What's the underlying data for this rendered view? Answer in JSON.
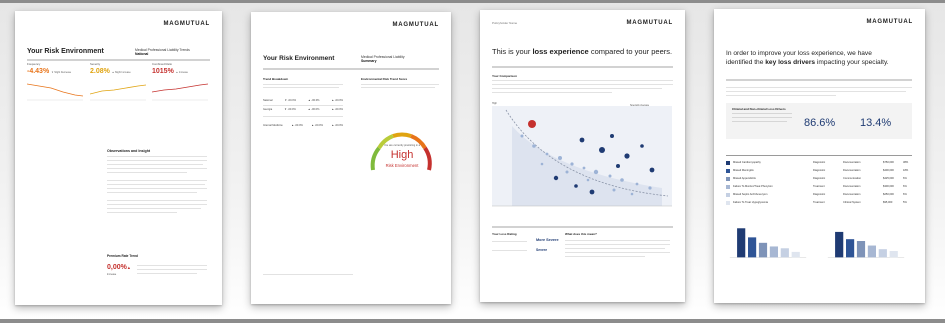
{
  "brand": "MAGMUTUAL",
  "colors": {
    "navy": "#1f3b73",
    "orange": "#e8741a",
    "gold": "#e0a411",
    "red": "#c5312e",
    "green": "#7fba3c",
    "gray": "#bdbdbd",
    "light_blue": "#9db3d6",
    "shadow": "#8c8c8c"
  },
  "page1": {
    "title": "Your Risk Environment",
    "subtitle_line1": "Medical Professional Liability Trends",
    "subtitle_line2": "National",
    "metrics": [
      {
        "label": "Frequency",
        "value": "-4.43%",
        "note": "▼ Slight Decrease",
        "color": "#e8741a"
      },
      {
        "label": "Severity",
        "value": "2.08%",
        "note": "▲ Slight Increase",
        "color": "#e0a411"
      },
      {
        "label": "Combined Ratio",
        "value": "1015%",
        "note": "▲ Increase",
        "color": "#c5312e"
      }
    ],
    "section_heading": "Observations and Insight",
    "callout_heading": "Premium Rate Trend",
    "callout_value": "0,00%",
    "callout_arrow": "▲",
    "callout_label": "Increase"
  },
  "page2": {
    "title": "Your Risk Environment",
    "subtitle_line1": "Medical Professional Liability",
    "subtitle_line2": "Summary",
    "left_heading": "Trend Breakdown",
    "right_heading": "Environmental Risk Trend Score",
    "table_rows": [
      {
        "name": "National",
        "v1": "▼ -00.0%",
        "v2": "▲ -00.0%",
        "v3": "▲ -00.0%"
      },
      {
        "name": "Georgia",
        "v1": "▼ -00.0%",
        "v2": "▲ -00.0%",
        "v3": "▲ -00.0%"
      },
      {
        "name": "Internal Medicine",
        "v1": "▲ -00.0%",
        "v2": "▲ -00.0%",
        "v3": "▲ -00.0%"
      }
    ],
    "gauge_caption": "You are currently practicing in a",
    "gauge_value": "High",
    "gauge_label": "Risk Environment"
  },
  "page3": {
    "eyebrow": "Policyholder Name",
    "title_pre": "This is your ",
    "title_bold": "loss experience",
    "title_post": " compared to your peers.",
    "comparison_heading": "Your Comparison",
    "rating_heading": "Your Loss Rating",
    "rating_value": "More Severe",
    "rating_value_2": "Severe",
    "means_heading": "What does this mean?",
    "y_axis_label": "Freq",
    "y_axis_top": "High",
    "y_axis_low": "Low",
    "chart_legend_label": "Specialty Average"
  },
  "page4": {
    "title_line1": "In order to improve your loss experience, we have",
    "title_line2_pre": "identified the ",
    "title_line2_bold": "key loss drivers",
    "title_line2_post": " impacting your specialty.",
    "panel_heading": "Clinical and Non-clinical Loss Drivers",
    "stat1": "86.6%",
    "stat2": "13.4%",
    "drivers": [
      {
        "name": "Missed Cardiomyopathy",
        "category": "Diagnostic",
        "type": "Documentation",
        "amount": "$750,000",
        "pct": "38%",
        "color": "#1f3b73"
      },
      {
        "name": "Missed Meningitis",
        "category": "Diagnostic",
        "type": "Documentation",
        "amount": "$400,000",
        "pct": "18%",
        "color": "#2e5496"
      },
      {
        "name": "Missed Appendicitis",
        "category": "Diagnostic",
        "type": "Communication",
        "amount": "$425,000",
        "pct": "6%",
        "color": "#7e93b8"
      },
      {
        "name": "Failure To Monitor/Treat Phenytoin",
        "category": "Treatment",
        "type": "Documentation",
        "amount": "$300,000",
        "pct": "6%",
        "color": "#a7b7d3"
      },
      {
        "name": "Missed Septic Arch/Aneurysm",
        "category": "Diagnostic",
        "type": "Documentation",
        "amount": "$250,000",
        "pct": "6%",
        "color": "#c5d0e3"
      },
      {
        "name": "Failure To Treat Hypoglycemia",
        "category": "Treatment",
        "type": "Clinical System",
        "amount": "$95,000",
        "pct": "5%",
        "color": "#dfe5ef"
      }
    ]
  }
}
